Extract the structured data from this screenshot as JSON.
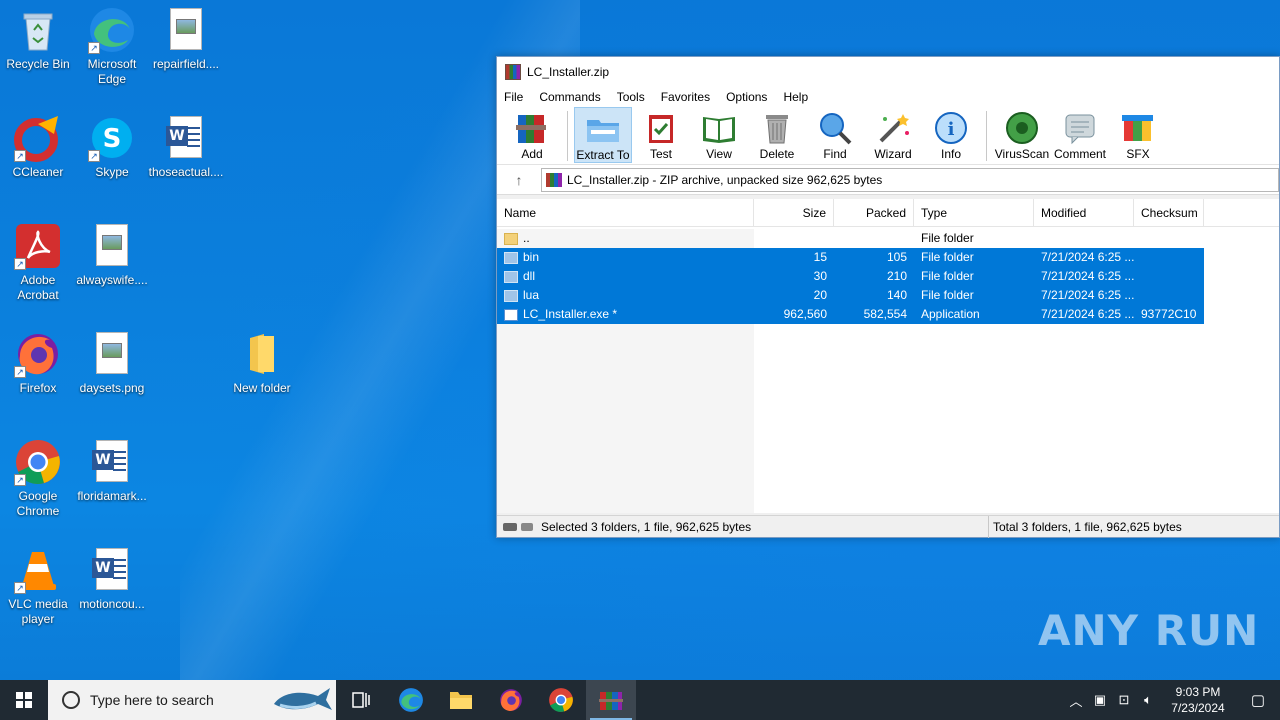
{
  "desktop": {
    "icons": [
      {
        "label": "Recycle Bin"
      },
      {
        "label": "Microsoft Edge"
      },
      {
        "label": "repairfield...."
      },
      {
        "label": "CCleaner"
      },
      {
        "label": "Skype"
      },
      {
        "label": "thoseactual...."
      },
      {
        "label": "Adobe Acrobat"
      },
      {
        "label": "alwayswife...."
      },
      {
        "label": "Firefox"
      },
      {
        "label": "daysets.png"
      },
      {
        "label": "New folder"
      },
      {
        "label": "Google Chrome"
      },
      {
        "label": "floridamark..."
      },
      {
        "label": "VLC media player"
      },
      {
        "label": "motioncou..."
      }
    ]
  },
  "winrar": {
    "title": "LC_Installer.zip",
    "menu": [
      "File",
      "Commands",
      "Tools",
      "Favorites",
      "Options",
      "Help"
    ],
    "toolbar": [
      "Add",
      "Extract To",
      "Test",
      "View",
      "Delete",
      "Find",
      "Wizard",
      "Info",
      "VirusScan",
      "Comment",
      "SFX"
    ],
    "address": "LC_Installer.zip - ZIP archive, unpacked size 962,625 bytes",
    "columns": [
      "Name",
      "Size",
      "Packed",
      "Type",
      "Modified",
      "Checksum"
    ],
    "rows": [
      {
        "name": "..",
        "size": "",
        "packed": "",
        "type": "File folder",
        "modified": "",
        "checksum": ""
      },
      {
        "name": "bin",
        "size": "15",
        "packed": "105",
        "type": "File folder",
        "modified": "7/21/2024 6:25 ...",
        "checksum": ""
      },
      {
        "name": "dll",
        "size": "30",
        "packed": "210",
        "type": "File folder",
        "modified": "7/21/2024 6:25 ...",
        "checksum": ""
      },
      {
        "name": "lua",
        "size": "20",
        "packed": "140",
        "type": "File folder",
        "modified": "7/21/2024 6:25 ...",
        "checksum": ""
      },
      {
        "name": "LC_Installer.exe *",
        "size": "962,560",
        "packed": "582,554",
        "type": "Application",
        "modified": "7/21/2024 6:25 ...",
        "checksum": "93772C10"
      }
    ],
    "status_left": "Selected 3 folders, 1 file, 962,625 bytes",
    "status_right": "Total 3 folders, 1 file, 962,625 bytes"
  },
  "taskbar": {
    "search_placeholder": "Type here to search",
    "time": "9:03 PM",
    "date": "7/23/2024"
  },
  "watermark": "ANY RUN"
}
